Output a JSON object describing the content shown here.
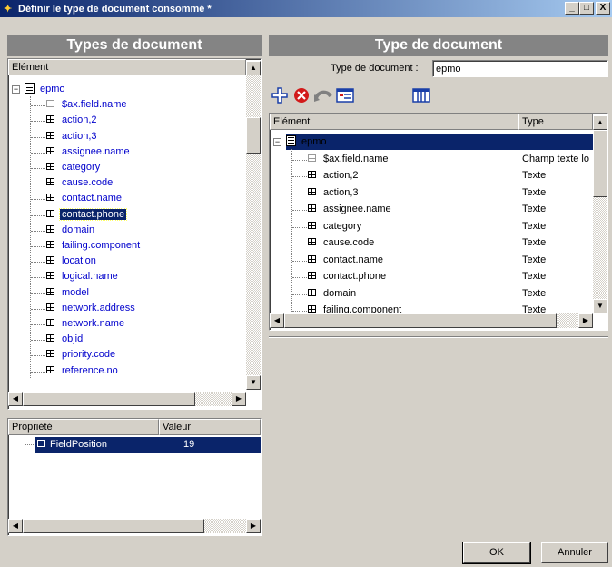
{
  "window": {
    "title": "Définir le type de document consommé *",
    "min_label": "_",
    "max_label": "□",
    "close_label": "X"
  },
  "left": {
    "header": "Types de document",
    "tree_column": "Elément",
    "root": "epmo",
    "items": [
      {
        "label": "$ax.field.name",
        "kind": "text"
      },
      {
        "label": "action,2",
        "kind": "field"
      },
      {
        "label": "action,3",
        "kind": "field"
      },
      {
        "label": "assignee.name",
        "kind": "field"
      },
      {
        "label": "category",
        "kind": "field"
      },
      {
        "label": "cause.code",
        "kind": "field"
      },
      {
        "label": "contact.name",
        "kind": "field"
      },
      {
        "label": "contact.phone",
        "kind": "field",
        "selected": true
      },
      {
        "label": "domain",
        "kind": "field"
      },
      {
        "label": "failing.component",
        "kind": "field"
      },
      {
        "label": "location",
        "kind": "field"
      },
      {
        "label": "logical.name",
        "kind": "field"
      },
      {
        "label": "model",
        "kind": "field"
      },
      {
        "label": "network.address",
        "kind": "field"
      },
      {
        "label": "network.name",
        "kind": "field"
      },
      {
        "label": "objid",
        "kind": "field"
      },
      {
        "label": "priority.code",
        "kind": "field"
      },
      {
        "label": "reference.no",
        "kind": "field"
      }
    ],
    "properties": {
      "col_property": "Propriété",
      "col_value": "Valeur",
      "rows": [
        {
          "name": "FieldPosition",
          "value": "19"
        }
      ]
    }
  },
  "right": {
    "header": "Type de document",
    "doc_type_label": "Type de document :",
    "doc_type_value": "epmo",
    "toolbar": {
      "add_icon": "add-icon",
      "delete_icon": "delete-icon",
      "undo_icon": "undo-icon",
      "form_icon": "form-icon",
      "table_icon": "table-icon"
    },
    "col_element": "Elément",
    "col_type": "Type",
    "root": "epmo",
    "items": [
      {
        "label": "$ax.field.name",
        "type": "Champ texte lo",
        "kind": "text"
      },
      {
        "label": "action,2",
        "type": "Texte",
        "kind": "field"
      },
      {
        "label": "action,3",
        "type": "Texte",
        "kind": "field"
      },
      {
        "label": "assignee.name",
        "type": "Texte",
        "kind": "field"
      },
      {
        "label": "category",
        "type": "Texte",
        "kind": "field"
      },
      {
        "label": "cause.code",
        "type": "Texte",
        "kind": "field"
      },
      {
        "label": "contact.name",
        "type": "Texte",
        "kind": "field"
      },
      {
        "label": "contact.phone",
        "type": "Texte",
        "kind": "field"
      },
      {
        "label": "domain",
        "type": "Texte",
        "kind": "field"
      },
      {
        "label": "failing.component",
        "type": "Texte",
        "kind": "field"
      }
    ]
  },
  "footer": {
    "ok_label": "OK",
    "cancel_label": "Annuler"
  },
  "colors": {
    "title_start": "#0a246a",
    "title_end": "#a6caf0",
    "panel_header": "#848484",
    "selection": "#0a246a",
    "link_text": "#0000cc",
    "face": "#d4d0c8"
  }
}
